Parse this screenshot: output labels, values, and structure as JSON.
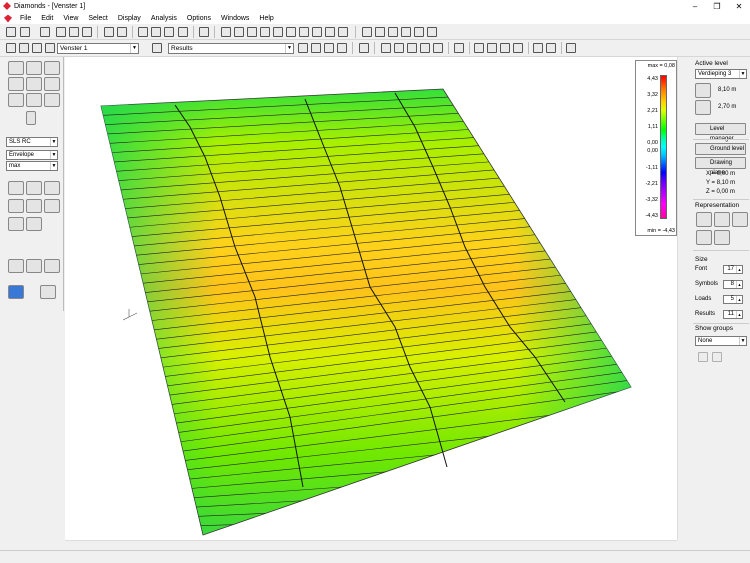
{
  "window": {
    "app": "Diamonds",
    "document": "[Venster 1]",
    "title": "Diamonds - [Venster 1]"
  },
  "menu": [
    "File",
    "Edit",
    "View",
    "Select",
    "Display",
    "Analysis",
    "Options",
    "Windows",
    "Help"
  ],
  "toolbar": {
    "view_combo": "Venster 1",
    "results_combo": "Results"
  },
  "left_panel": {
    "combo_sls": "SLS RC",
    "combo_envelope": "Envelope",
    "combo_max": "max"
  },
  "legend": {
    "max_label": "max = 0,08",
    "min_label": "min = -4,43",
    "values": [
      "4,43",
      "3,32",
      "2,21",
      "1,11",
      "0,00",
      "0,00",
      "-1,11",
      "-2,21",
      "-3,32",
      "-4,43"
    ]
  },
  "right_panel": {
    "active_level_label": "Active level",
    "active_level_value": "Verdieping 3",
    "level_height_1": "8,10 m",
    "level_height_2": "2,70 m",
    "level_manager": "Level manager",
    "ground_level": "Ground level",
    "drawing_plane": "Drawing plane",
    "x": "X =    0,00 m",
    "y": "Y =    8,10 m",
    "z": "Z =    0,00 m",
    "representation_label": "Representation",
    "size_label": "Size",
    "font_label": "Font",
    "font_value": "17",
    "symbols_label": "Symbols",
    "symbols_value": "8",
    "loads_label": "Loads",
    "loads_value": "5",
    "results_label": "Results",
    "results_value": "11",
    "show_groups_label": "Show groups",
    "show_groups_value": "None"
  },
  "colors": {
    "field_high": "#ffcc00",
    "field_mid": "#c8f000",
    "field_low": "#22dd22",
    "legend_top": "#ff0000",
    "legend_bottom": "#ff00a0"
  }
}
